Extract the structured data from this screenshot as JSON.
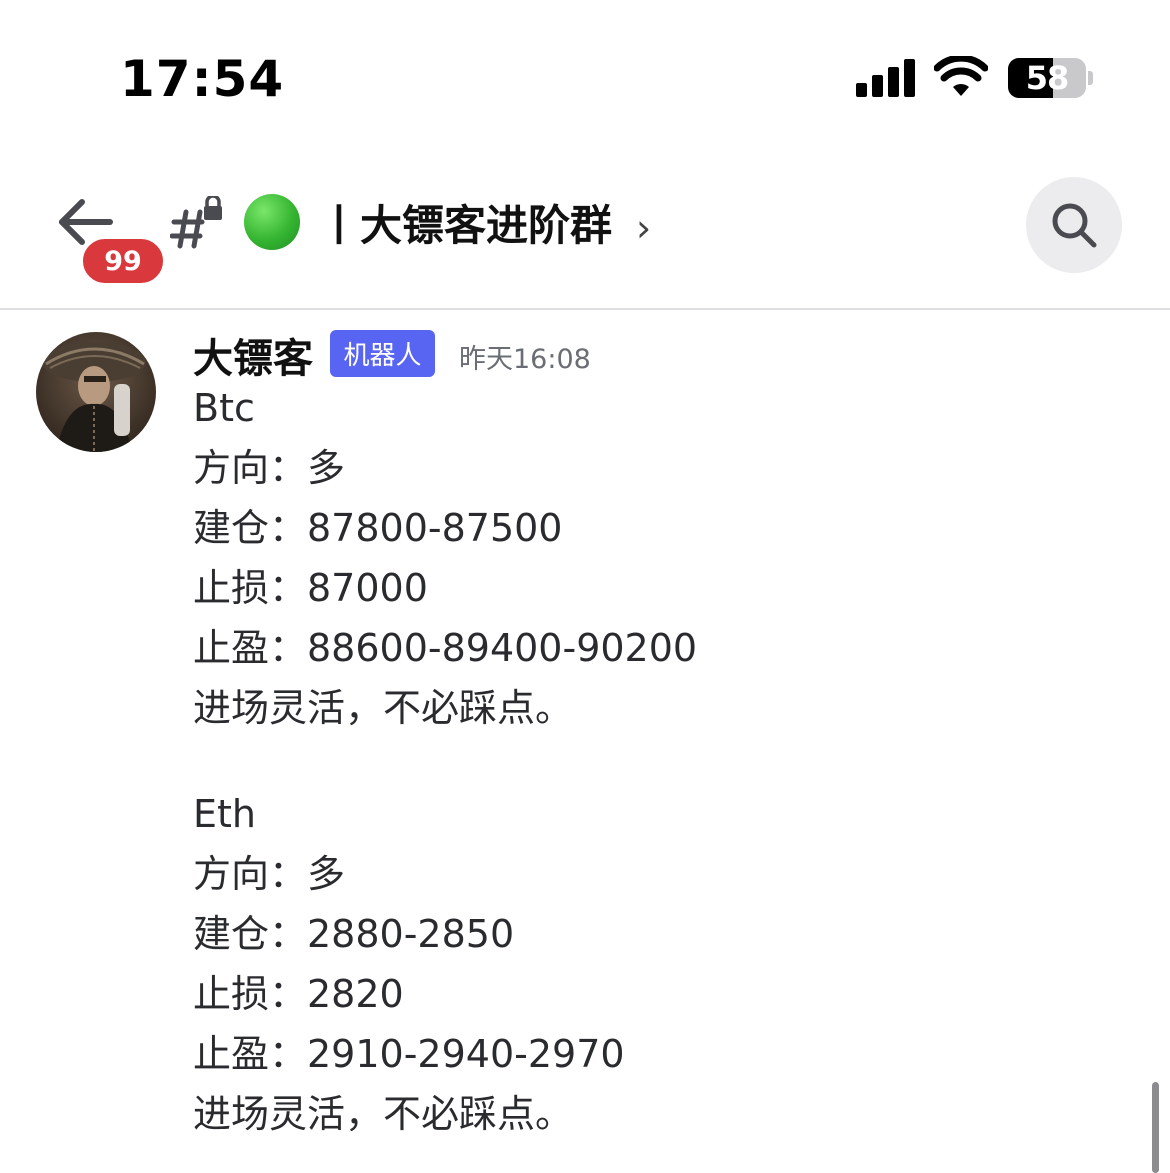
{
  "status_bar": {
    "time": "17:54",
    "battery_level": "58",
    "icons": [
      "cellular-signal-icon",
      "wifi-icon",
      "battery-icon"
    ]
  },
  "header": {
    "unread_count": "99",
    "channel_icon": "locked-channel-hash-icon",
    "status_emoji": "green-circle",
    "channel_name": "丨大镖客进阶群",
    "chevron": "›",
    "search_icon": "search-icon"
  },
  "message": {
    "author": "大镖客",
    "badge": "机器人",
    "timestamp": "昨天16:08",
    "btc": {
      "symbol": "Btc",
      "direction": "方向：多",
      "entry": "建仓：87800-87500",
      "stop_loss": "止损：87000",
      "take_profit": "止盈：88600-89400-90200",
      "note": "进场灵活，不必踩点。"
    },
    "eth": {
      "symbol": "Eth",
      "direction": "方向：多",
      "entry": "建仓：2880-2850",
      "stop_loss": "止损：2820",
      "take_profit": "止盈：2910-2940-2970",
      "note": "进场灵活，不必踩点。"
    }
  },
  "colors": {
    "badge_red": "#d9383c",
    "bot_badge_blue": "#5865f2",
    "status_green": "#35b531",
    "timestamp_gray": "#6b6d74"
  }
}
